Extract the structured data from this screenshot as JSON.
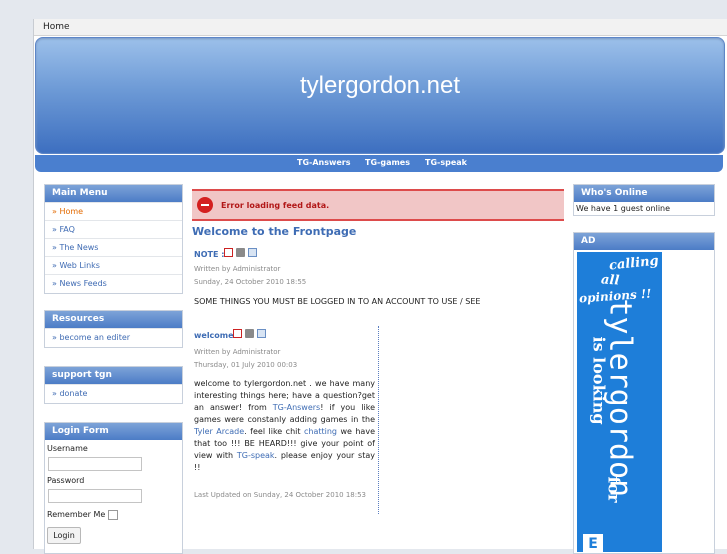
{
  "breadcrumb": {
    "home": "Home"
  },
  "site": {
    "title": "tylergordon.net"
  },
  "nav": {
    "items": [
      "TG-Answers",
      "TG-games",
      "TG-speak"
    ]
  },
  "main_menu": {
    "title": "Main Menu",
    "items": [
      "» Home",
      "» FAQ",
      "» The News",
      "» Web Links",
      "» News Feeds"
    ]
  },
  "resources": {
    "title": "Resources",
    "items": [
      "» become an editer"
    ]
  },
  "support": {
    "title": "support tgn",
    "items": [
      "» donate"
    ]
  },
  "login": {
    "title": "Login Form",
    "username_label": "Username",
    "password_label": "Password",
    "remember_label": "Remember Me",
    "button_label": "Login",
    "username_value": "",
    "password_value": ""
  },
  "error": {
    "message": "Error loading feed data."
  },
  "content": {
    "page_title": "Welcome to the Frontpage",
    "note": {
      "title": "NOTE :",
      "author": "Written by Administrator",
      "date": "Sunday, 24 October 2010 18:55",
      "body": "SOME THINGS YOU MUST BE LOGGED IN TO AN ACCOUNT TO USE / SEE"
    },
    "welcome": {
      "title": "welcome",
      "author": "Written by Administrator",
      "date": "Thursday, 01 July 2010 00:03",
      "text_1": "welcome to tylergordon.net .  we have many interesting things here;  have a question?get an answer! from ",
      "link_answers": "TG-Answers",
      "text_2": "! if you like games were constanly adding games in the ",
      "link_arcade": "Tyler Arcade",
      "text_3": ". feel like chit ",
      "link_chatting": "chatting",
      "text_4": " we have that too !!!     BE HEARD!!! give your point of view with ",
      "link_speak": "TG-speak",
      "text_5": ". please enjoy your stay !!",
      "updated": "Last Updated on Sunday, 24 October 2010 18:53"
    }
  },
  "whos_online": {
    "title": "Who's Online",
    "text": "We have 1 guest online"
  },
  "ad": {
    "title": "AD",
    "text_1": "calling",
    "text_2": "all",
    "text_3": "opinions !!",
    "text_4": "tylergordon",
    "text_5": "is looking",
    "text_6": "for",
    "text_7": "E"
  },
  "colors": {
    "accent": "#3e6cb4",
    "header": "#4a7fcf",
    "error": "#dd4b4b",
    "active": "#e36a00"
  }
}
